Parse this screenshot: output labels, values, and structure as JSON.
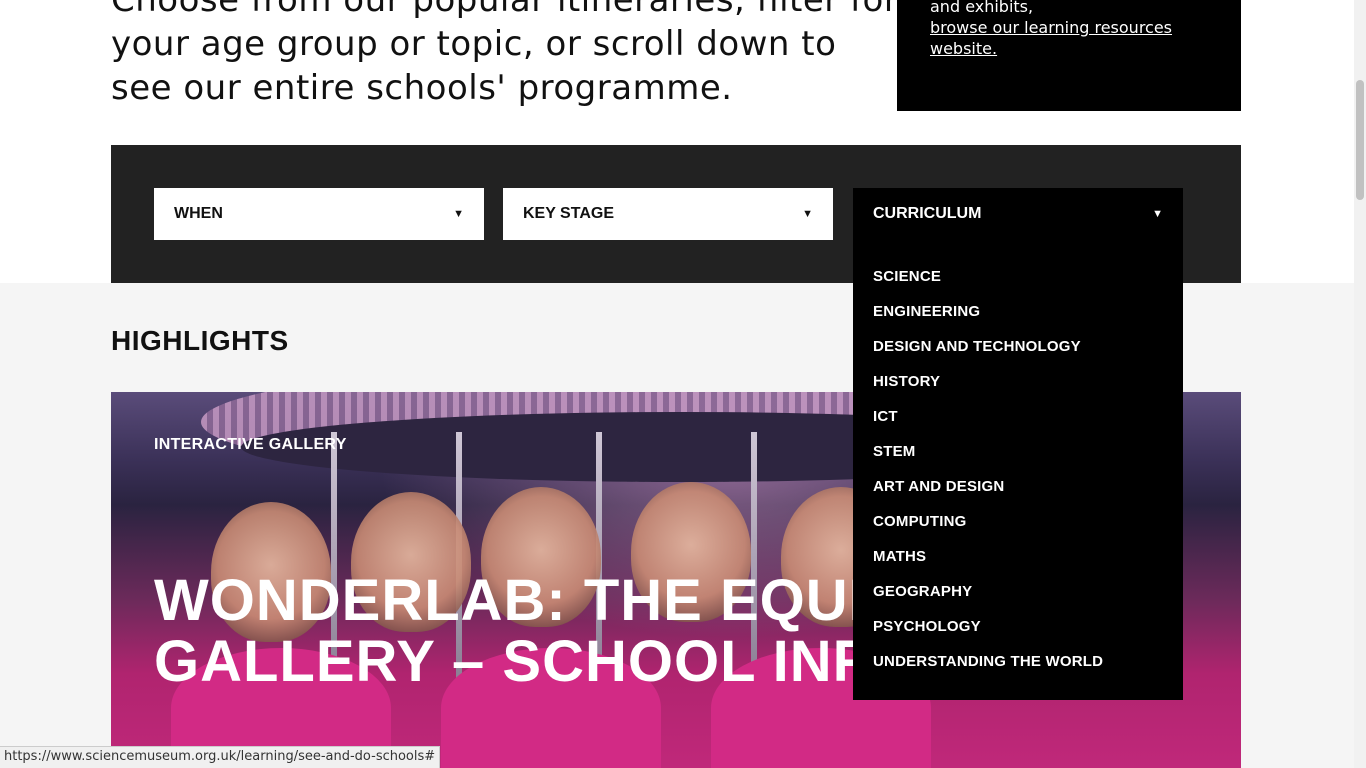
{
  "intro": {
    "line1": "Choose from our popular itineraries, filter for",
    "line2": "your age group or topic, or scroll down to",
    "line3": "see our entire schools' programme."
  },
  "promo": {
    "text": "and exhibits,",
    "link": "browse our learning resources",
    "link2": "website."
  },
  "filters": {
    "when": "WHEN",
    "key_stage": "KEY STAGE",
    "curriculum": "CURRICULUM",
    "arrow": "▼"
  },
  "curriculum_options": [
    "SCIENCE",
    "ENGINEERING",
    "DESIGN AND TECHNOLOGY",
    "HISTORY",
    "ICT",
    "STEM",
    "ART AND DESIGN",
    "COMPUTING",
    "MATHS",
    "GEOGRAPHY",
    "PSYCHOLOGY",
    "UNDERSTANDING THE WORLD"
  ],
  "highlights": {
    "heading": "HIGHLIGHTS",
    "card_label": "INTERACTIVE GALLERY",
    "card_title_line1": "WONDERLAB: THE EQUINOR",
    "card_title_line2": "GALLERY – SCHOOL INFO"
  },
  "status_bar": {
    "url": "https://www.sciencemuseum.org.uk/learning/see-and-do-schools#"
  }
}
